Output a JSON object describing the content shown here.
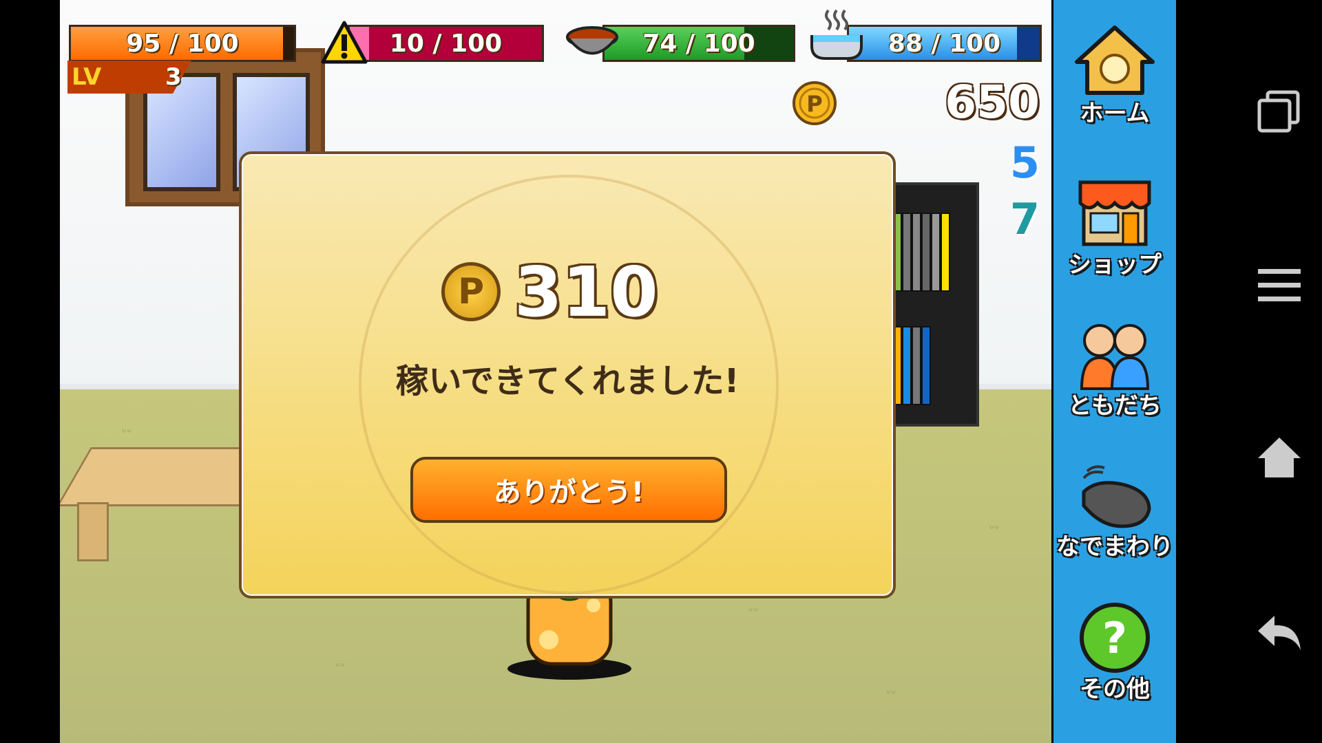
{
  "stats": {
    "health": {
      "text": "95 / 100",
      "value": 95,
      "max": 100,
      "color": "#ff7a00"
    },
    "stress": {
      "text": "10 / 100",
      "value": 10,
      "max": 100,
      "color": "#c0003c"
    },
    "food": {
      "text": "74 / 100",
      "value": 74,
      "max": 100,
      "color": "#2aa32a"
    },
    "bath": {
      "text": "88 / 100",
      "value": 88,
      "max": 100,
      "color": "#3a8ff0"
    }
  },
  "level": {
    "label": "LV",
    "value": "3"
  },
  "currency": {
    "points": "650",
    "gems": "5",
    "tickets": "7"
  },
  "reward_modal": {
    "amount": "310",
    "coin_symbol": "P",
    "message": "稼いできてくれました!",
    "button_label": "ありがとう!"
  },
  "menu": [
    {
      "label": "ホーム",
      "icon": "home-icon"
    },
    {
      "label": "ショップ",
      "icon": "shop-icon"
    },
    {
      "label": "ともだち",
      "icon": "friends-icon"
    },
    {
      "label": "なでまわり",
      "icon": "petting-hand-icon"
    },
    {
      "label": "その他",
      "icon": "help-icon"
    }
  ],
  "system_nav": [
    "recent-apps-icon",
    "menu-icon",
    "home-icon",
    "back-icon"
  ]
}
